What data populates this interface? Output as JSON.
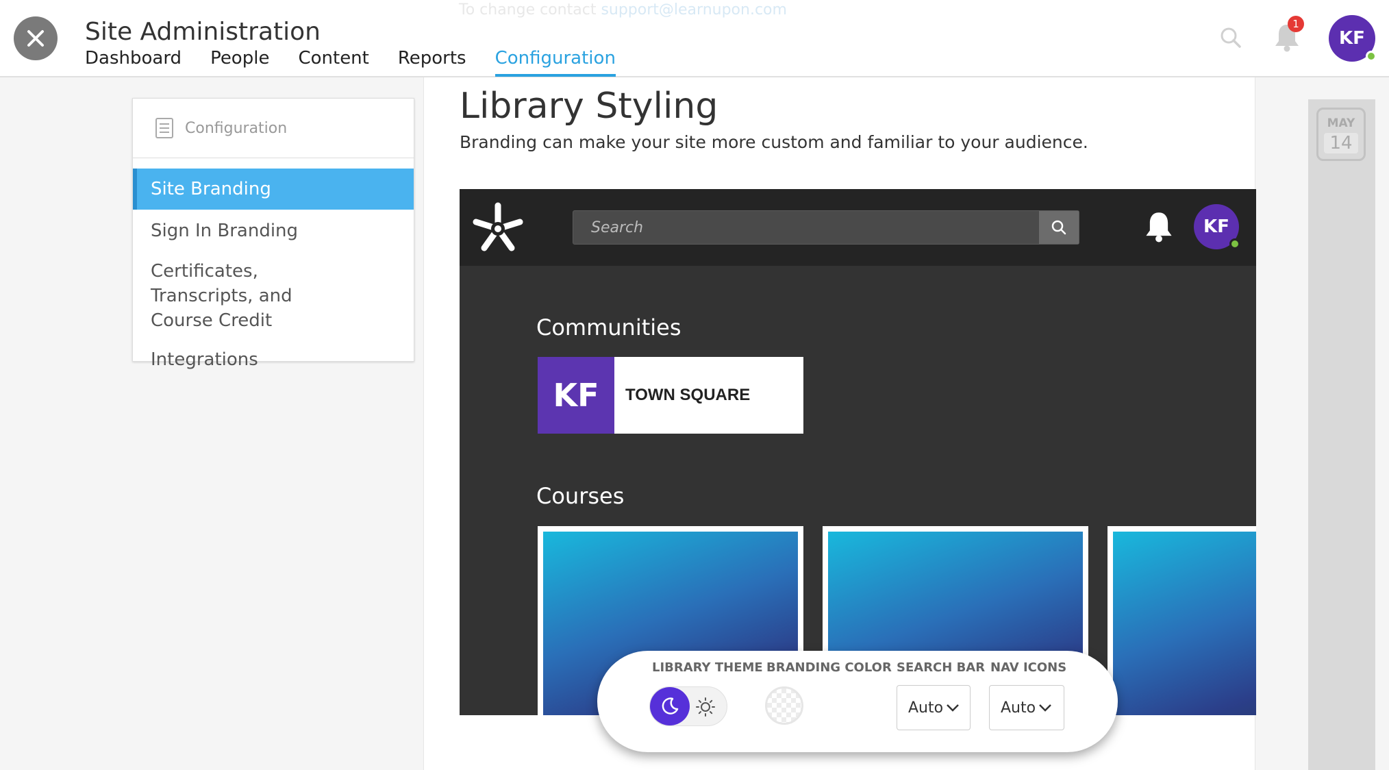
{
  "header": {
    "title": "Site Administration",
    "faded_note": "To change contact ",
    "faded_link": "support@learnupon.com",
    "notification_count": "1",
    "avatar_initials": "KF"
  },
  "nav": {
    "items": [
      "Dashboard",
      "People",
      "Content",
      "Reports",
      "Configuration"
    ],
    "active": "Configuration"
  },
  "sidebar": {
    "heading": "Configuration",
    "items": [
      {
        "label": "Site Branding",
        "active": true
      },
      {
        "label": "Sign In Branding",
        "active": false
      },
      {
        "label": "Certificates, Transcripts, and Course Credit",
        "active": false
      },
      {
        "label": "Integrations",
        "active": false
      }
    ]
  },
  "main": {
    "title": "Library Styling",
    "subtitle": "Branding can make your site more custom and familiar to your audience."
  },
  "preview": {
    "search_placeholder": "Search",
    "avatar_initials": "KF",
    "communities_heading": "Communities",
    "community": {
      "initials": "KF",
      "name": "TOWN SQUARE",
      "tile_color": "#5c35b0"
    },
    "courses_heading": "Courses",
    "theme": "dark",
    "background_color": "#333333",
    "bar_color": "#242424"
  },
  "toolbar": {
    "library_theme_label": "LIBRARY THEME",
    "branding_color_label": "BRANDING COLOR",
    "search_bar_label": "SEARCH BAR",
    "nav_icons_label": "NAV ICONS",
    "search_bar_value": "Auto",
    "nav_icons_value": "Auto",
    "theme_selected": "dark"
  },
  "calendar": {
    "month": "MAY",
    "day": "14"
  },
  "colors": {
    "accent": "#2aa2e0",
    "sidebar_active": "#4ab3ef",
    "avatar": "#5c2fb0",
    "theme_toggle": "#5630d9",
    "online": "#7cc242",
    "badge": "#e53935"
  },
  "icons": [
    "close-icon",
    "search-icon",
    "bell-icon",
    "document-icon",
    "snowflake-logo-icon",
    "moon-icon",
    "sun-icon",
    "chevron-down-icon"
  ]
}
